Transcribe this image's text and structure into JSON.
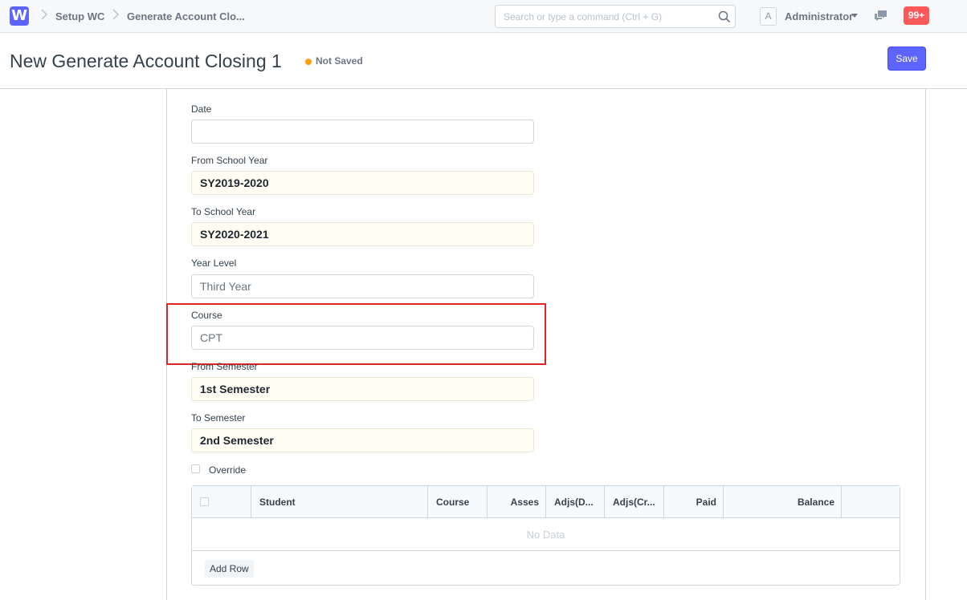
{
  "navbar": {
    "logo_letter": "W",
    "breadcrumbs": [
      "Setup WC",
      "Generate Account Clo..."
    ],
    "search_placeholder": "Search or type a command (Ctrl + G)",
    "avatar_letter": "A",
    "user_name": "Administrator",
    "notification_count": "99+"
  },
  "page": {
    "title": "New Generate Account Closing 1",
    "status": "Not Saved",
    "save_label": "Save"
  },
  "form": {
    "date": {
      "label": "Date",
      "value": ""
    },
    "from_school_year": {
      "label": "From School Year",
      "value": "SY2019-2020"
    },
    "to_school_year": {
      "label": "To School Year",
      "value": "SY2020-2021"
    },
    "year_level": {
      "label": "Year Level",
      "value": "Third Year"
    },
    "course": {
      "label": "Course",
      "value": "CPT"
    },
    "from_semester": {
      "label": "From Semester",
      "value": "1st Semester"
    },
    "to_semester": {
      "label": "To Semester",
      "value": "2nd Semester"
    },
    "override": {
      "label": "Override",
      "checked": false
    }
  },
  "grid": {
    "columns": [
      "Student",
      "Course",
      "Asses",
      "Adjs(D...",
      "Adjs(Cr...",
      "Paid",
      "Balance"
    ],
    "empty_text": "No Data",
    "add_row_label": "Add Row"
  },
  "colors": {
    "accent": "#5e64ff",
    "status_dot": "#ffa00a",
    "notification": "#ff5858",
    "highlight": "#e02424"
  }
}
